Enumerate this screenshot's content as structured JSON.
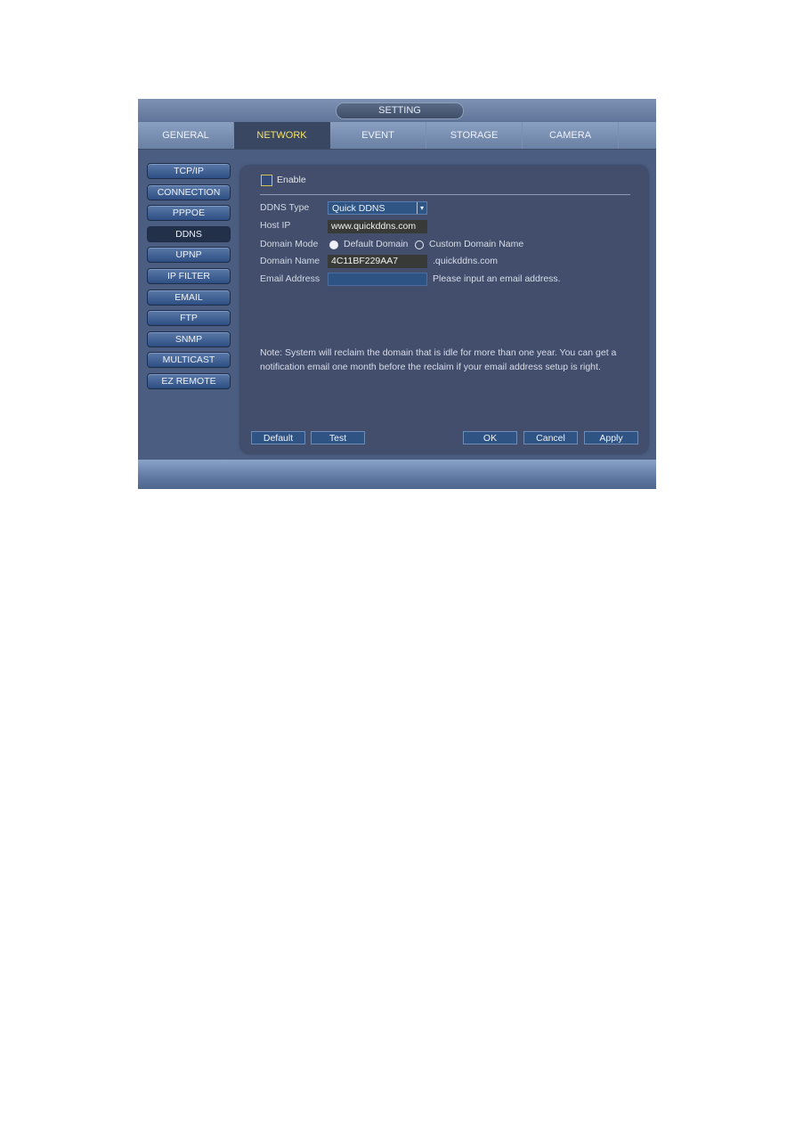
{
  "window": {
    "title": "SETTING"
  },
  "tabs": [
    {
      "label": "GENERAL",
      "active": false
    },
    {
      "label": "NETWORK",
      "active": true
    },
    {
      "label": "EVENT",
      "active": false
    },
    {
      "label": "STORAGE",
      "active": false
    },
    {
      "label": "CAMERA",
      "active": false
    }
  ],
  "sidebar": {
    "items": [
      {
        "label": "TCP/IP"
      },
      {
        "label": "CONNECTION"
      },
      {
        "label": "PPPOE"
      },
      {
        "label": "DDNS",
        "active": true
      },
      {
        "label": "UPNP"
      },
      {
        "label": "IP FILTER"
      },
      {
        "label": "EMAIL"
      },
      {
        "label": "FTP"
      },
      {
        "label": "SNMP"
      },
      {
        "label": "MULTICAST"
      },
      {
        "label": "EZ REMOTE"
      }
    ]
  },
  "form": {
    "enable_label": "Enable",
    "enable_checked": false,
    "ddns_type_label": "DDNS Type",
    "ddns_type_value": "Quick DDNS",
    "host_ip_label": "Host IP",
    "host_ip_value": "www.quickddns.com",
    "domain_mode_label": "Domain Mode",
    "domain_mode_options": [
      "Default Domain",
      "Custom Domain Name"
    ],
    "domain_mode_selected": "Default Domain",
    "domain_name_label": "Domain Name",
    "domain_name_value": "4C11BF229AA7",
    "domain_suffix": ".quickddns.com",
    "email_label": "Email Address",
    "email_value": "",
    "email_hint": "Please input an email address.",
    "note": "Note: System will reclaim the domain that is idle for more than one year. You can get a notification email one month before the reclaim if your email address setup is right."
  },
  "buttons": {
    "default": "Default",
    "test": "Test",
    "ok": "OK",
    "cancel": "Cancel",
    "apply": "Apply"
  }
}
